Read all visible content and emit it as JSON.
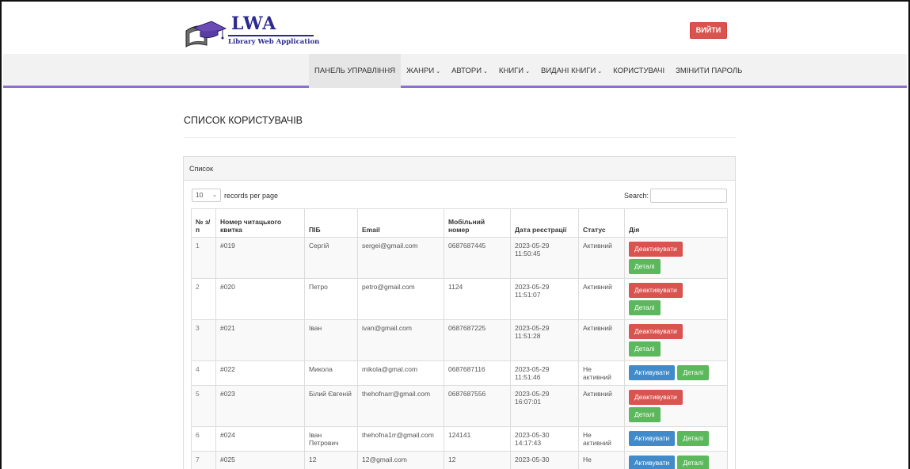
{
  "logo": {
    "title": "LWA",
    "subtitle": "Library Web Application"
  },
  "header": {
    "logout_label": "ВИЙТИ"
  },
  "nav": {
    "items": [
      {
        "label": "ПАНЕЛЬ УПРАВЛІННЯ",
        "dropdown": false,
        "active": true
      },
      {
        "label": "ЖАНРИ",
        "dropdown": true
      },
      {
        "label": "АВТОРИ",
        "dropdown": true
      },
      {
        "label": "КНИГИ",
        "dropdown": true
      },
      {
        "label": "ВИДАНІ КНИГИ",
        "dropdown": true
      },
      {
        "label": "КОРИСТУВАЧІ",
        "dropdown": false
      },
      {
        "label": "ЗМІНИТИ ПАРОЛЬ",
        "dropdown": false
      }
    ]
  },
  "page": {
    "title": "СПИСОК КОРИСТУВАЧІВ"
  },
  "panel": {
    "heading": "Список",
    "length_value": "10",
    "length_suffix": "records per page",
    "search_label": "Search:",
    "search_value": ""
  },
  "table": {
    "columns": [
      "№ з/п",
      "Номер читацького квитка",
      "ПІБ",
      "Email",
      "Мобільний номер",
      "Дата реєстрації",
      "Статус",
      "Дія"
    ],
    "rows": [
      {
        "n": "1",
        "card": "#019",
        "name": "Сергій",
        "email": "sergei@gmail.com",
        "phone": "0687687445",
        "date": "2023-05-29 11:50:45",
        "status": "Активний",
        "actions": [
          "Деактивувати",
          "Деталі"
        ]
      },
      {
        "n": "2",
        "card": "#020",
        "name": "Петро",
        "email": "petro@gmail.com",
        "phone": "1124",
        "date": "2023-05-29 11:51:07",
        "status": "Активний",
        "actions": [
          "Деактивувати",
          "Деталі"
        ]
      },
      {
        "n": "3",
        "card": "#021",
        "name": "Іван",
        "email": "ivan@gmail.com",
        "phone": "0687687225",
        "date": "2023-05-29 11:51:28",
        "status": "Активний",
        "actions": [
          "Деактивувати",
          "Деталі"
        ]
      },
      {
        "n": "4",
        "card": "#022",
        "name": "Микола",
        "email": "mikola@gmal.com",
        "phone": "0687687116",
        "date": "2023-05-29 11:51:46",
        "status": "Не активний",
        "actions": [
          "Активувати",
          "Деталі"
        ]
      },
      {
        "n": "5",
        "card": "#023",
        "name": "Білий Євгеній",
        "email": "thehofnarr@gmail.com",
        "phone": "0687687556",
        "date": "2023-05-29 16:07:01",
        "status": "Активний",
        "actions": [
          "Деактивувати",
          "Деталі"
        ]
      },
      {
        "n": "6",
        "card": "#024",
        "name": "Іван Петрович",
        "email": "thehofna1rr@gmail.com",
        "phone": "124141",
        "date": "2023-05-30 14:17:43",
        "status": "Не активний",
        "actions": [
          "Активувати",
          "Деталі"
        ]
      },
      {
        "n": "7",
        "card": "#025",
        "name": "12",
        "email": "12@gmail.com",
        "phone": "12",
        "date": "2023-05-30",
        "status": "Не",
        "actions": [
          "Активувати",
          "Деталі"
        ]
      }
    ]
  },
  "colors": {
    "accent": "#8e6fd1",
    "danger": "#d9534f",
    "success": "#5cb85c",
    "primary": "#428bca",
    "brand": "#2c2a8e"
  }
}
